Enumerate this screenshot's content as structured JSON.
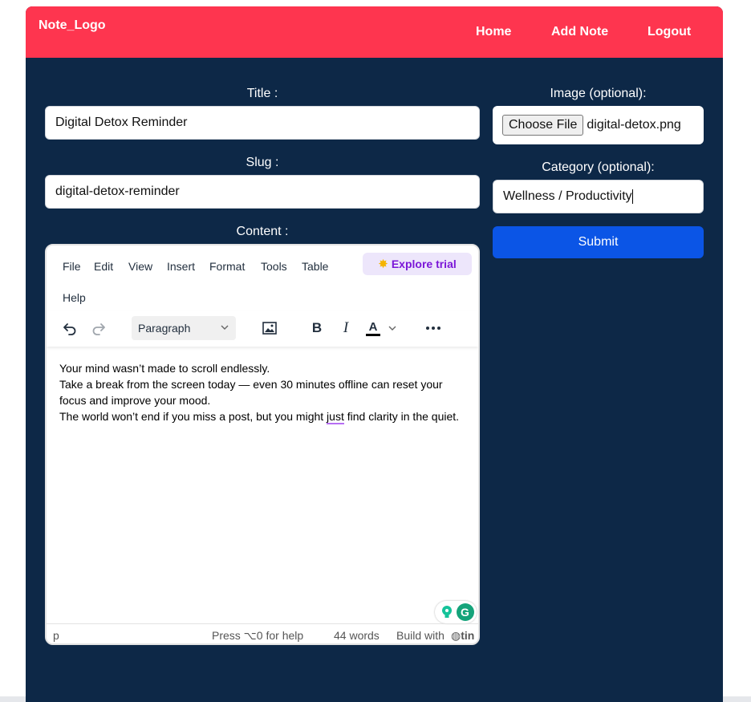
{
  "nav": {
    "logo": "Note_Logo",
    "links": [
      "Home",
      "Add Note",
      "Logout"
    ]
  },
  "form": {
    "title_label": "Title :",
    "title_value": "Digital Detox Reminder",
    "slug_label": "Slug :",
    "slug_value": "digital-detox-reminder",
    "content_label": "Content :",
    "image_label": "Image (optional):",
    "file_button": "Choose File",
    "file_name": "digital-detox.png",
    "category_label": "Category (optional):",
    "category_value": "Wellness / Productivity",
    "submit_label": "Submit"
  },
  "editor": {
    "menu": [
      "File",
      "Edit",
      "View",
      "Insert",
      "Format",
      "Tools",
      "Table",
      "Help"
    ],
    "explore_label": "Explore trial",
    "block_format": "Paragraph",
    "content_lines": [
      "Your mind wasn’t made to scroll endlessly.",
      "Take a break from the screen today — even 30 minutes offline can reset your focus and improve your mood.",
      "The world won’t end if you miss a post, but you might ",
      "just",
      " find clarity in the quiet."
    ],
    "status": {
      "path": "p",
      "help": "Press ⌥0 for help",
      "words": "44 words",
      "build": "Build with"
    }
  },
  "colors": {
    "navbar": "#fe354f",
    "background": "#0d2847",
    "submit": "#0b55e6",
    "explore": "#7b17d8"
  },
  "icons": [
    "undo-icon",
    "redo-icon",
    "image-icon",
    "bold-icon",
    "italic-icon",
    "text-color-icon",
    "more-icon",
    "chevron-down-icon",
    "sparkle-icon",
    "grammarly-icon",
    "lightbulb-icon"
  ]
}
